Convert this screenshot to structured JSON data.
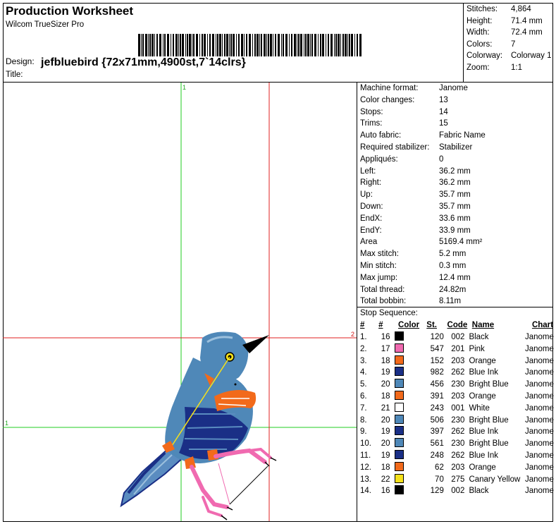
{
  "header": {
    "title": "Production Worksheet",
    "subtitle": "Wilcom TrueSizer Pro",
    "barcode_text": "{||||||||||||||||,|||||||||||||,|||`||||||||}",
    "design_label": "Design:",
    "design_value": "jefbluebird {72x71mm,4900st,7`14clrs}",
    "title_label": "Title:"
  },
  "stats": [
    {
      "label": "Stitches:",
      "value": "4,864"
    },
    {
      "label": "Height:",
      "value": "71.4 mm"
    },
    {
      "label": "Width:",
      "value": "72.4 mm"
    },
    {
      "label": "Colors:",
      "value": "7"
    },
    {
      "label": "Colorway:",
      "value": "Colorway 1"
    },
    {
      "label": "Zoom:",
      "value": "1:1"
    }
  ],
  "canvas": {
    "guide_labels": {
      "top_green": "1",
      "left_green": "1",
      "right_red": "2"
    },
    "colors": {
      "guide_green": "#22cc22",
      "guide_red": "#e02020"
    }
  },
  "info": [
    {
      "label": "Machine format:",
      "value": "Janome"
    },
    {
      "label": "Color changes:",
      "value": "13"
    },
    {
      "label": "Stops:",
      "value": "14"
    },
    {
      "label": "Trims:",
      "value": "15"
    },
    {
      "label": "Auto fabric:",
      "value": "Fabric Name"
    },
    {
      "label": "Required stabilizer:",
      "value": "Stabilizer"
    },
    {
      "label": "Appliqués:",
      "value": "0"
    },
    {
      "label": "Left:",
      "value": "36.2 mm"
    },
    {
      "label": "Right:",
      "value": "36.2 mm"
    },
    {
      "label": "Up:",
      "value": "35.7 mm"
    },
    {
      "label": "Down:",
      "value": "35.7 mm"
    },
    {
      "label": "EndX:",
      "value": "33.6 mm"
    },
    {
      "label": "EndY:",
      "value": "33.9 mm"
    },
    {
      "label": "Area",
      "value": "5169.4 mm²"
    },
    {
      "label": "Max stitch:",
      "value": "5.2 mm"
    },
    {
      "label": "Min stitch:",
      "value": "0.3 mm"
    },
    {
      "label": "Max jump:",
      "value": "12.4 mm"
    },
    {
      "label": "Total thread:",
      "value": "24.82m"
    },
    {
      "label": "Total bobbin:",
      "value": "8.11m"
    }
  ],
  "sequence": {
    "title": "Stop Sequence:",
    "headers": {
      "idx": "#",
      "num": "#",
      "color": "Color",
      "st": "St.",
      "code": "Code",
      "name": "Name",
      "chart": "Chart"
    },
    "rows": [
      {
        "idx": "1.",
        "num": "16",
        "swatch": "#000000",
        "st": "120",
        "code": "002",
        "name": "Black",
        "chart": "Janome"
      },
      {
        "idx": "2.",
        "num": "17",
        "swatch": "#f06ab0",
        "st": "547",
        "code": "201",
        "name": "Pink",
        "chart": "Janome"
      },
      {
        "idx": "3.",
        "num": "18",
        "swatch": "#f26a1b",
        "st": "152",
        "code": "203",
        "name": "Orange",
        "chart": "Janome"
      },
      {
        "idx": "4.",
        "num": "19",
        "swatch": "#1a2f86",
        "st": "982",
        "code": "262",
        "name": "Blue Ink",
        "chart": "Janome"
      },
      {
        "idx": "5.",
        "num": "20",
        "swatch": "#4f88b8",
        "st": "456",
        "code": "230",
        "name": "Bright Blue",
        "chart": "Janome"
      },
      {
        "idx": "6.",
        "num": "18",
        "swatch": "#f26a1b",
        "st": "391",
        "code": "203",
        "name": "Orange",
        "chart": "Janome"
      },
      {
        "idx": "7.",
        "num": "21",
        "swatch": "#ffffff",
        "st": "243",
        "code": "001",
        "name": "White",
        "chart": "Janome"
      },
      {
        "idx": "8.",
        "num": "20",
        "swatch": "#4f88b8",
        "st": "506",
        "code": "230",
        "name": "Bright Blue",
        "chart": "Janome"
      },
      {
        "idx": "9.",
        "num": "19",
        "swatch": "#1a2f86",
        "st": "397",
        "code": "262",
        "name": "Blue Ink",
        "chart": "Janome"
      },
      {
        "idx": "10.",
        "num": "20",
        "swatch": "#4f88b8",
        "st": "561",
        "code": "230",
        "name": "Bright Blue",
        "chart": "Janome"
      },
      {
        "idx": "11.",
        "num": "19",
        "swatch": "#1a2f86",
        "st": "248",
        "code": "262",
        "name": "Blue Ink",
        "chart": "Janome"
      },
      {
        "idx": "12.",
        "num": "18",
        "swatch": "#f26a1b",
        "st": "62",
        "code": "203",
        "name": "Orange",
        "chart": "Janome"
      },
      {
        "idx": "13.",
        "num": "22",
        "swatch": "#f5e11a",
        "st": "70",
        "code": "275",
        "name": "Canary Yellow",
        "chart": "Janome"
      },
      {
        "idx": "14.",
        "num": "16",
        "swatch": "#000000",
        "st": "129",
        "code": "002",
        "name": "Black",
        "chart": "Janome"
      }
    ]
  }
}
